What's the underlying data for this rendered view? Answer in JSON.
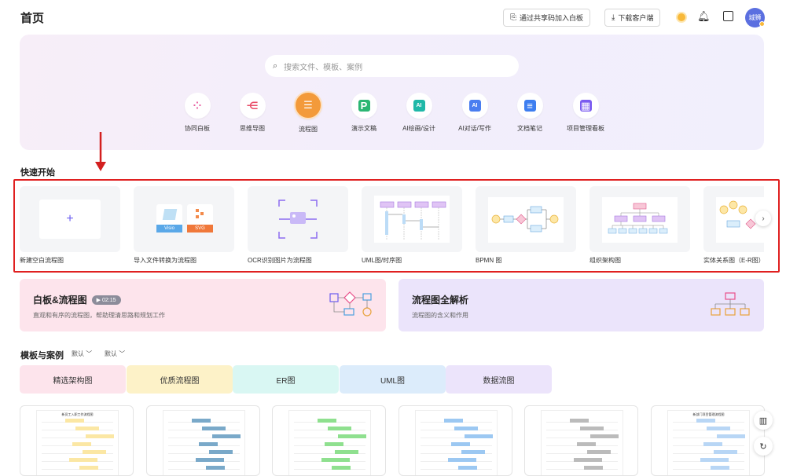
{
  "header": {
    "title": "首页",
    "join_board_label": "通过共享码加入白板",
    "download_label": "下载客户端",
    "avatar_text": "城狮"
  },
  "hero": {
    "search_placeholder": "搜索文件、模板、案例",
    "categories": [
      {
        "label": "协同白板",
        "icon": "whiteboard-icon"
      },
      {
        "label": "思维导图",
        "icon": "mindmap-icon"
      },
      {
        "label": "流程图",
        "icon": "flowchart-icon"
      },
      {
        "label": "演示文稿",
        "icon": "presentation-icon"
      },
      {
        "label": "AI绘画/设计",
        "icon": "ai-paint-icon"
      },
      {
        "label": "AI对话/写作",
        "icon": "ai-chat-icon"
      },
      {
        "label": "文档笔记",
        "icon": "doc-icon"
      },
      {
        "label": "项目管理看板",
        "icon": "kanban-icon"
      }
    ],
    "active_category": "流程图"
  },
  "quick_start": {
    "title": "快速开始",
    "items": [
      {
        "label": "新建空白流程图"
      },
      {
        "label": "导入文件转换为流程图",
        "tag1": "Visio",
        "tag2": "SVG"
      },
      {
        "label": "OCR识别图片为流程图"
      },
      {
        "label": "UML图/时序图"
      },
      {
        "label": "BPMN 图"
      },
      {
        "label": "组织架构图"
      },
      {
        "label": "实体关系图（E-R图）"
      }
    ]
  },
  "promos": [
    {
      "title": "白板&流程图",
      "badge": "▶ 02:15",
      "subtitle": "直观和有序的流程图，帮助理清思路和规划工作",
      "bg": "#fde4ec"
    },
    {
      "title": "流程图全解析",
      "subtitle": "流程图的含义和作用",
      "bg": "#ebe4fb"
    }
  ],
  "templates": {
    "title": "模板与案例",
    "sort1": "默认",
    "sort2": "默认",
    "tabs": [
      {
        "label": "精选架构图",
        "bg": "#fde4ec"
      },
      {
        "label": "优质流程图",
        "bg": "#fdf2c8"
      },
      {
        "label": "ER图",
        "bg": "#d9f7f3"
      },
      {
        "label": "UML图",
        "bg": "#dcecfb"
      },
      {
        "label": "数据流图",
        "bg": "#ece4fb"
      }
    ],
    "cards": [
      {
        "name": "template-card-1",
        "heading": "新员工入职工作流程图"
      },
      {
        "name": "template-card-2",
        "heading": ""
      },
      {
        "name": "template-card-3",
        "heading": ""
      },
      {
        "name": "template-card-4",
        "heading": ""
      },
      {
        "name": "template-card-5",
        "heading": ""
      },
      {
        "name": "template-card-6",
        "heading": "新部门项目管理流程图"
      }
    ]
  },
  "colors": {
    "accent": "#f39a3a",
    "red_highlight": "#e02020",
    "avatar": "#5b6fe0"
  }
}
